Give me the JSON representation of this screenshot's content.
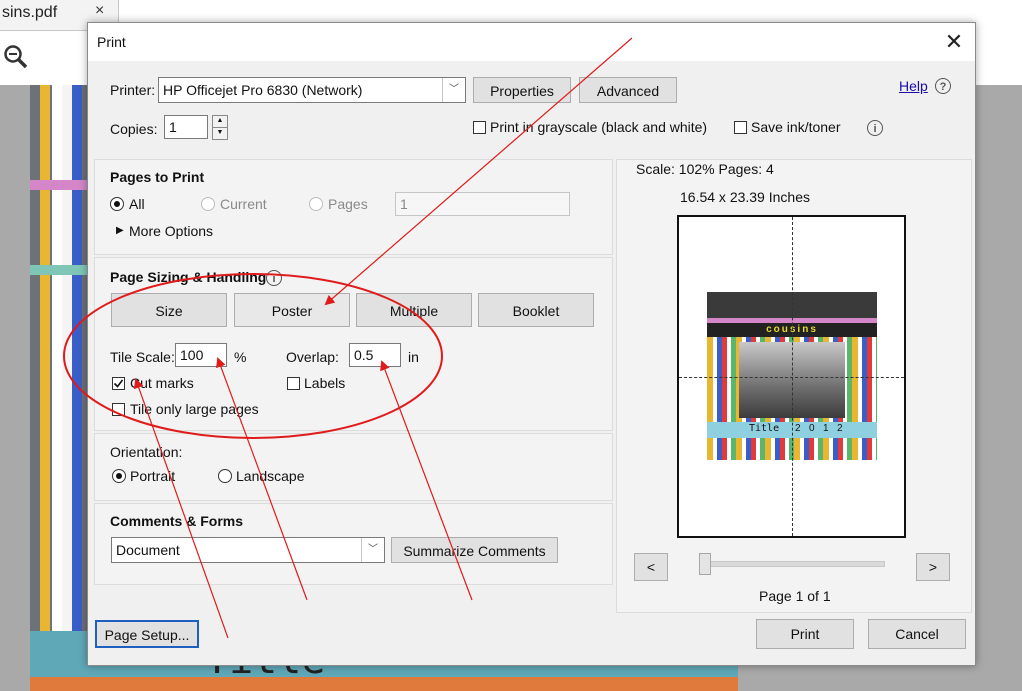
{
  "background": {
    "tab_title": "sins.pdf",
    "tab_close": "×",
    "bottom_text": "Title"
  },
  "dialog": {
    "title": "Print",
    "close": "✕",
    "help": "Help",
    "help_icon": "?",
    "printer": {
      "label": "Printer:",
      "value": "HP Officejet Pro 6830 (Network)",
      "properties": "Properties",
      "advanced": "Advanced"
    },
    "copies": {
      "label": "Copies:",
      "value": "1"
    },
    "grayscale": {
      "label": "Print in grayscale (black and white)",
      "checked": false
    },
    "save_ink": {
      "label": "Save ink/toner",
      "checked": false
    },
    "info_icon": "i",
    "pages_to_print": {
      "heading": "Pages to Print",
      "all": "All",
      "current": "Current",
      "pages": "Pages",
      "pages_value": "1",
      "more_options": "More Options"
    },
    "sizing": {
      "heading": "Page Sizing & Handling",
      "size": "Size",
      "poster": "Poster",
      "multiple": "Multiple",
      "booklet": "Booklet",
      "tile_scale_label": "Tile Scale:",
      "tile_scale_value": "100",
      "tile_scale_unit": "%",
      "overlap_label": "Overlap:",
      "overlap_value": "0.5",
      "overlap_unit": "in",
      "cut_marks": "Cut marks",
      "labels": "Labels",
      "tile_large": "Tile only large pages"
    },
    "orientation": {
      "heading": "Orientation:",
      "portrait": "Portrait",
      "landscape": "Landscape"
    },
    "comments": {
      "heading": "Comments & Forms",
      "value": "Document",
      "summarize": "Summarize Comments"
    },
    "preview": {
      "scale_text": "Scale: 102% Pages: 4",
      "size_text": "16.54 x 23.39 Inches",
      "prev": "<",
      "next": ">",
      "page_text": "Page 1 of 1",
      "thumb_word": "cousins",
      "thumb_title": "Title",
      "thumb_nums": [
        "2",
        "0",
        "1",
        "2"
      ]
    },
    "page_setup": "Page Setup...",
    "print": "Print",
    "cancel": "Cancel"
  },
  "colors": {
    "annotation": "#e01b1b",
    "link": "#1a0dab"
  }
}
